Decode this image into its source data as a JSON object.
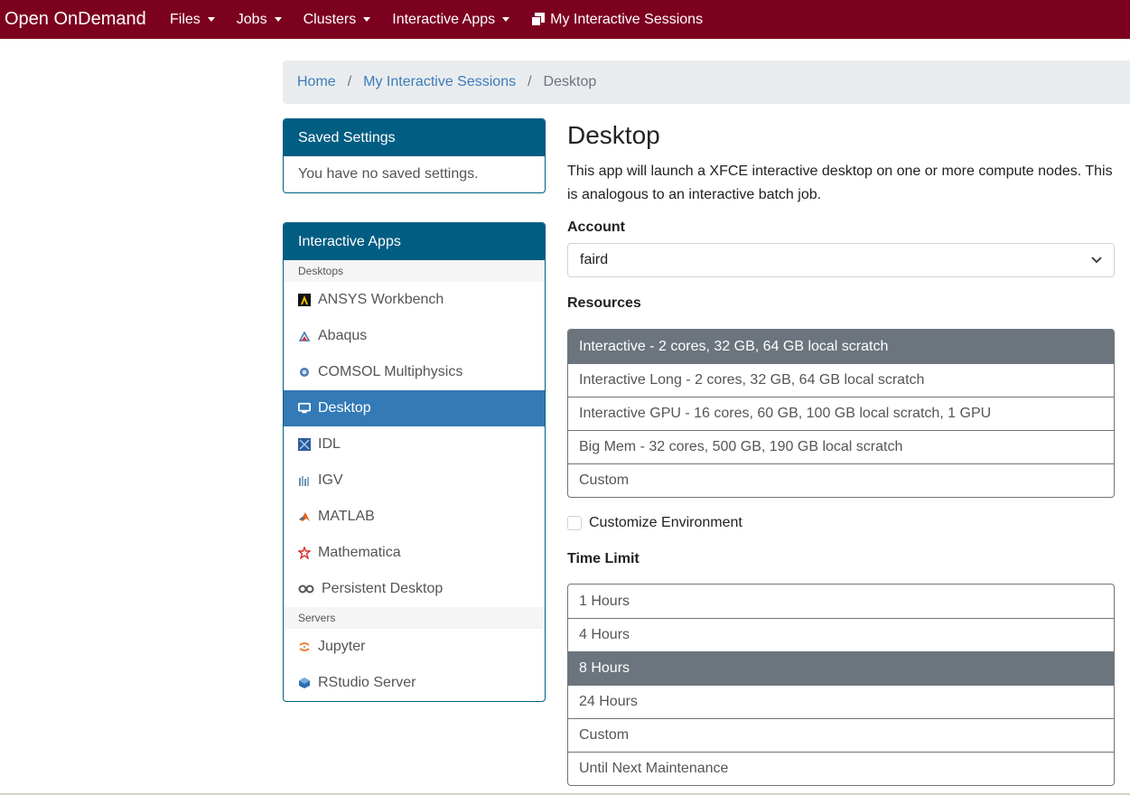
{
  "navbar": {
    "brand": "Open OnDemand",
    "menus": [
      {
        "label": "Files"
      },
      {
        "label": "Jobs"
      },
      {
        "label": "Clusters"
      },
      {
        "label": "Interactive Apps"
      }
    ],
    "sessions_label": "My Interactive Sessions",
    "background_color": "#7c0020"
  },
  "breadcrumb": {
    "home": "Home",
    "sessions": "My Interactive Sessions",
    "current": "Desktop"
  },
  "saved_settings": {
    "title": "Saved Settings",
    "empty_text": "You have no saved settings."
  },
  "apps_panel": {
    "title": "Interactive Apps",
    "groups": [
      {
        "header": "Desktops",
        "items": [
          {
            "label": "ANSYS Workbench",
            "icon": "ansys-icon"
          },
          {
            "label": "Abaqus",
            "icon": "abaqus-icon"
          },
          {
            "label": "COMSOL Multiphysics",
            "icon": "comsol-icon"
          },
          {
            "label": "Desktop",
            "icon": "monitor-icon",
            "active": true
          },
          {
            "label": "IDL",
            "icon": "idl-icon"
          },
          {
            "label": "IGV",
            "icon": "igv-icon"
          },
          {
            "label": "MATLAB",
            "icon": "matlab-icon"
          },
          {
            "label": "Mathematica",
            "icon": "mathematica-icon"
          },
          {
            "label": "Persistent Desktop",
            "icon": "infinity-icon"
          }
        ]
      },
      {
        "header": "Servers",
        "items": [
          {
            "label": "Jupyter",
            "icon": "jupyter-icon"
          },
          {
            "label": "RStudio Server",
            "icon": "rstudio-icon"
          }
        ]
      }
    ],
    "header_color": "#015d82",
    "active_color": "#337ab7"
  },
  "form": {
    "title": "Desktop",
    "description": "This app will launch a XFCE interactive desktop on one or more compute nodes. This is analogous to an interactive batch job.",
    "account": {
      "label": "Account",
      "value": "faird"
    },
    "resources": {
      "label": "Resources",
      "options": [
        "Interactive - 2 cores, 32 GB, 64 GB local scratch",
        "Interactive Long - 2 cores, 32 GB, 64 GB local scratch",
        "Interactive GPU - 16 cores, 60 GB, 100 GB local scratch, 1 GPU",
        "Big Mem - 32 cores, 500 GB, 190 GB local scratch",
        "Custom"
      ],
      "selected": "Interactive - 2 cores, 32 GB, 64 GB local scratch"
    },
    "customize_env": {
      "label": "Customize Environment",
      "checked": false
    },
    "time_limit": {
      "label": "Time Limit",
      "options": [
        "1 Hours",
        "4 Hours",
        "8 Hours",
        "24 Hours",
        "Custom",
        "Until Next Maintenance"
      ],
      "selected": "8 Hours"
    },
    "selected_color": "#6c757d"
  }
}
